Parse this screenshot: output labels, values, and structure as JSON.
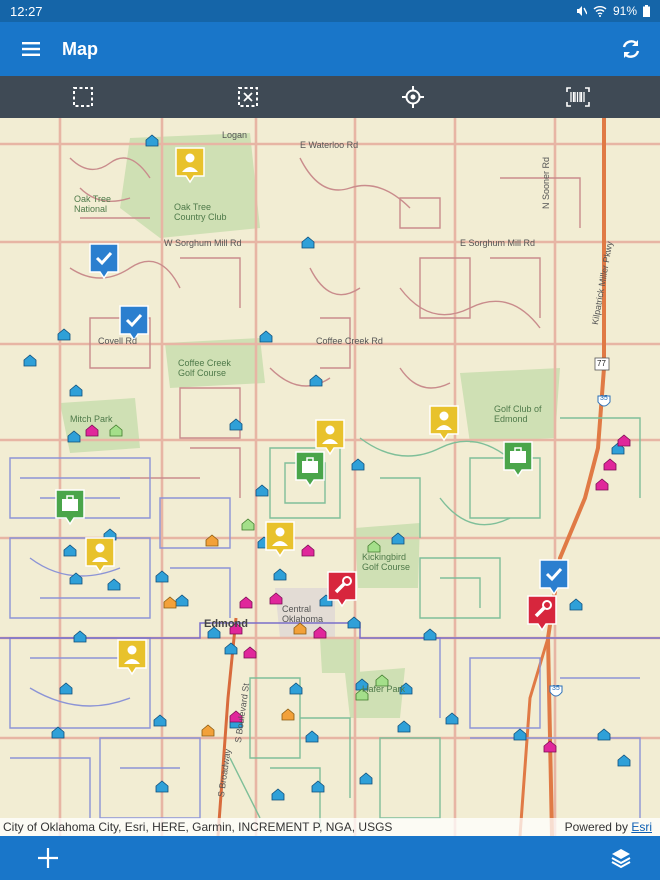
{
  "status": {
    "time": "12:27",
    "battery": "91%"
  },
  "app_bar": {
    "title": "Map"
  },
  "toolbar": {
    "tools": [
      {
        "name": "select-area-icon"
      },
      {
        "name": "clear-selection-icon"
      },
      {
        "name": "locate-icon"
      },
      {
        "name": "barcode-icon"
      }
    ]
  },
  "map": {
    "labels": {
      "logan": "Logan",
      "waterloo": "E Waterloo Rd",
      "oaktree_national": "Oak Tree National",
      "oaktree_cc": "Oak Tree Country Club",
      "sorghum_w": "W Sorghum Mill Rd",
      "sorghum_e": "E Sorghum Mill Rd",
      "sooner": "N Sooner Rd",
      "covell": "Covell Rd",
      "coffee_creek": "Coffee Creek Rd",
      "coffee_creek_golf": "Coffee Creek Golf Course",
      "mitch_park": "Mitch Park",
      "golf_club_edmond": "Golf Club of Edmond",
      "kickingbird": "Kickingbird Golf Course",
      "central_oklahoma": "Central Oklahoma",
      "hafer_park": "Hafer Park",
      "edmond": "Edmond",
      "turnpike": "Kilpatrick Miller Pkwy",
      "boulevard": "S Boulevard St",
      "broadway": "S Broadway",
      "hwy77": "77",
      "hwy35": "35",
      "i35": "35"
    }
  },
  "attribution": {
    "sources": "City of Oklahoma City, Esri, HERE, Garmin, INCREMENT P, NGA, USGS",
    "powered_prefix": "Powered by",
    "powered_link": "Esri"
  },
  "colors": {
    "status_bar": "#1565a8",
    "app_bar": "#1976c9",
    "toolbar": "#3f4a55",
    "map_bg": "#f2edd3",
    "marker_yellow": "#e8c22c",
    "marker_green": "#4aa54a",
    "marker_red": "#d7263d",
    "marker_blue": "#2b7fcf"
  }
}
